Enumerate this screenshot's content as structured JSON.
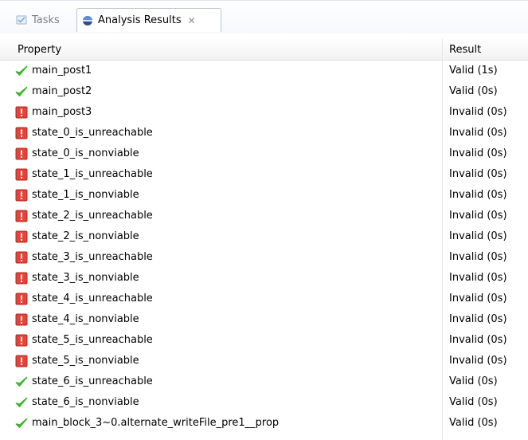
{
  "tabs": [
    {
      "label": "Tasks",
      "active": false,
      "icon": "tasks-icon"
    },
    {
      "label": "Analysis Results",
      "active": true,
      "icon": "analysis-icon",
      "close": "✕"
    }
  ],
  "table": {
    "columns": [
      "Property",
      "Result"
    ],
    "rows": [
      {
        "status": "valid",
        "property": "main_post1",
        "result": "Valid (1s)"
      },
      {
        "status": "valid",
        "property": "main_post2",
        "result": "Valid (0s)"
      },
      {
        "status": "invalid",
        "property": "main_post3",
        "result": "Invalid (0s)"
      },
      {
        "status": "invalid",
        "property": "state_0_is_unreachable",
        "result": "Invalid (0s)"
      },
      {
        "status": "invalid",
        "property": "state_0_is_nonviable",
        "result": "Invalid (0s)"
      },
      {
        "status": "invalid",
        "property": "state_1_is_unreachable",
        "result": "Invalid (0s)"
      },
      {
        "status": "invalid",
        "property": "state_1_is_nonviable",
        "result": "Invalid (0s)"
      },
      {
        "status": "invalid",
        "property": "state_2_is_unreachable",
        "result": "Invalid (0s)"
      },
      {
        "status": "invalid",
        "property": "state_2_is_nonviable",
        "result": "Invalid (0s)"
      },
      {
        "status": "invalid",
        "property": "state_3_is_unreachable",
        "result": "Invalid (0s)"
      },
      {
        "status": "invalid",
        "property": "state_3_is_nonviable",
        "result": "Invalid (0s)"
      },
      {
        "status": "invalid",
        "property": "state_4_is_unreachable",
        "result": "Invalid (0s)"
      },
      {
        "status": "invalid",
        "property": "state_4_is_nonviable",
        "result": "Invalid (0s)"
      },
      {
        "status": "invalid",
        "property": "state_5_is_unreachable",
        "result": "Invalid (0s)"
      },
      {
        "status": "invalid",
        "property": "state_5_is_nonviable",
        "result": "Invalid (0s)"
      },
      {
        "status": "valid",
        "property": "state_6_is_unreachable",
        "result": "Valid (0s)"
      },
      {
        "status": "valid",
        "property": "state_6_is_nonviable",
        "result": "Valid (0s)"
      },
      {
        "status": "valid",
        "property": "main_block_3~0.alternate_writeFile_pre1__prop",
        "result": "Valid (0s)"
      }
    ]
  },
  "colors": {
    "valid": "#3cb62e",
    "invalid": "#e0443a"
  }
}
